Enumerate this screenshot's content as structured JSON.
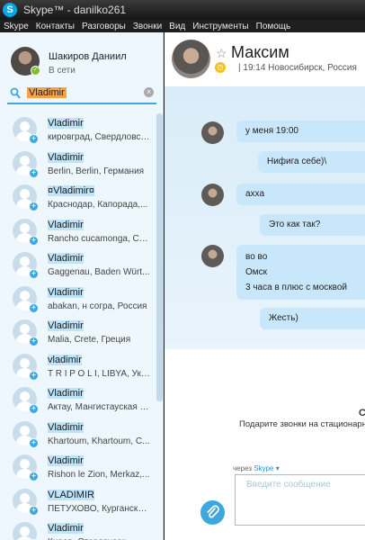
{
  "window": {
    "title": "Skype™ - danilko261",
    "logo_letter": "S"
  },
  "menu": [
    "Skype",
    "Контакты",
    "Разговоры",
    "Звонки",
    "Вид",
    "Инструменты",
    "Помощь"
  ],
  "profile": {
    "name": "Шакиров Даниил",
    "status": "В сети"
  },
  "search": {
    "value": "Vladimir",
    "clear_symbol": "×"
  },
  "contacts": [
    {
      "name": "Vladimir",
      "location": "кировград, Свердловская..."
    },
    {
      "name": "Vladimir",
      "location": "Berlin, Berlin, Германия"
    },
    {
      "name": "¤Vladimir¤",
      "location": "Краснодар, Капорада,..."
    },
    {
      "name": "Vladimir",
      "location": "Rancho cucamonga, Ca..."
    },
    {
      "name": "  Vladimir",
      "location": "Gaggenau, Baden  Würt..."
    },
    {
      "name": "Vladimir",
      "location": "abakan, н согра, Россия"
    },
    {
      "name": "Vladimir",
      "location": "Malia, Crete, Греция"
    },
    {
      "name": "vladimir",
      "location": "T R I P O L I, LIBYA, Укр..."
    },
    {
      "name": "Vladimir",
      "location": "Актау, Мангистауская о..."
    },
    {
      "name": "Vladimir",
      "location": "Khartoum, Khartoum, C..."
    },
    {
      "name": "Vladimir",
      "location": "Rishon le Zion, Merkaz,..."
    },
    {
      "name": "VLADIMIR",
      "location": "ПЕТУХОВО, Курганска..."
    },
    {
      "name": "Vladimir",
      "location": "Киров, Старорусск..."
    }
  ],
  "conversation": {
    "name": "Максим",
    "star_symbol": "☆",
    "subtitle": "|  19:14 Новосибирск, Россия",
    "messages": [
      {
        "from": "them",
        "lines": [
          "у меня 19:00"
        ]
      },
      {
        "from": "me",
        "lines": [
          "Нифига себе)\\"
        ]
      },
      {
        "from": "them",
        "lines": [
          "ахха"
        ]
      },
      {
        "from": "me",
        "lines": [
          "Это как так?"
        ]
      },
      {
        "from": "them",
        "lines": [
          "во во",
          "Омск",
          "3 часа в плюс с москвой"
        ]
      },
      {
        "from": "me",
        "lines": [
          "Жесть)"
        ]
      }
    ]
  },
  "promo": {
    "title": "С",
    "text": "Подарите звонки на стационарн"
  },
  "compose": {
    "via_label": "через",
    "via_link": "Skype ▾",
    "placeholder": "Введите сообщение"
  },
  "colors": {
    "accent": "#3ea7dc",
    "highlight": "#f6a34a",
    "sidebar_bg": "#eef7fd",
    "bubble": "#c9e7fa",
    "online": "#7dbb2f",
    "away": "#f2c31d"
  },
  "icons": {
    "attach": "paperclip-icon",
    "search": "search-icon",
    "status_online": "check-icon",
    "status_away": "clock-icon",
    "add_contact": "plus-icon"
  }
}
